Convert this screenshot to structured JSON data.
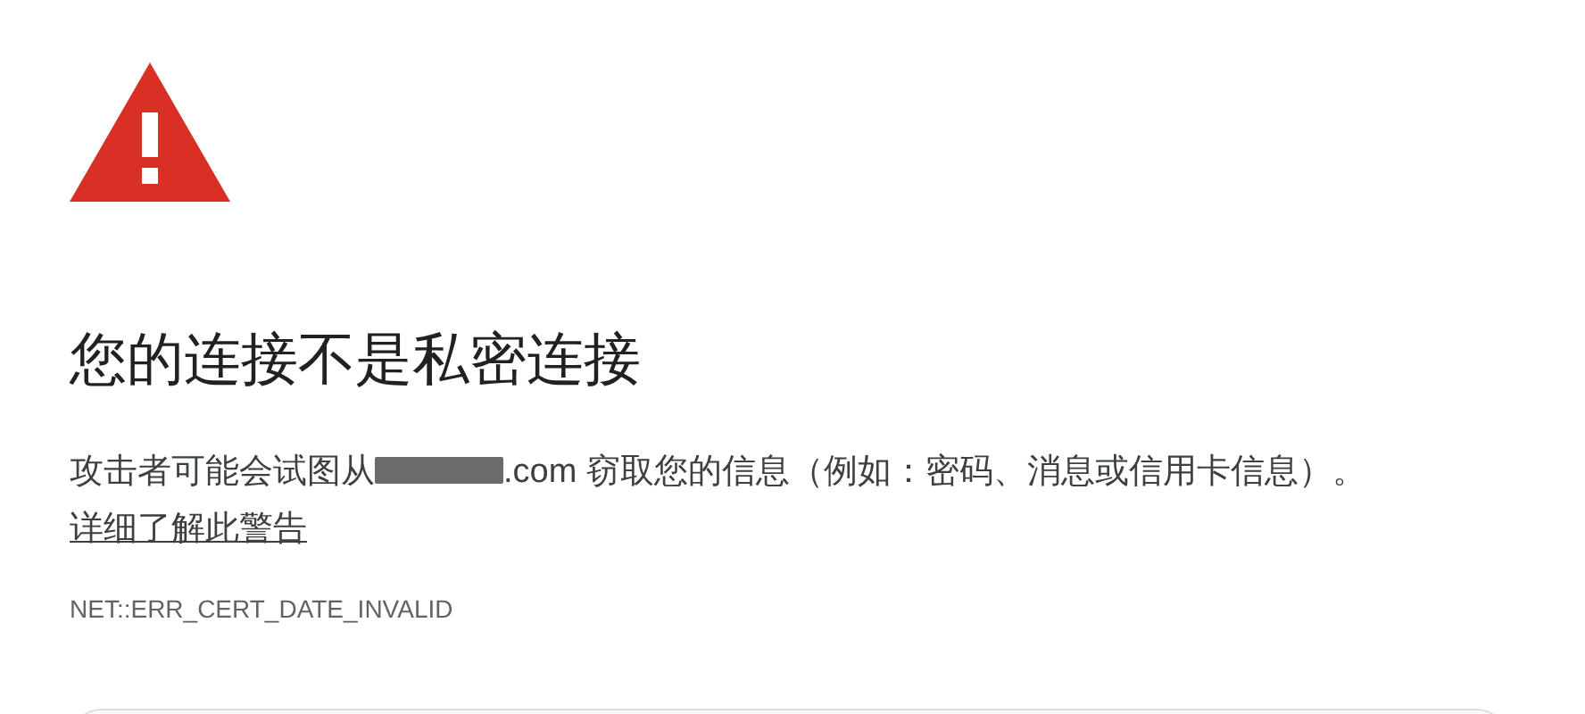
{
  "heading": "您的连接不是私密连接",
  "message": {
    "text_before": "攻击者可能会试图从",
    "text_after": ".com 窃取您的信息（例如：密码、消息或信用卡信息）。",
    "link": "详细了解此警告"
  },
  "error_code": "NET::ERR_CERT_DATE_INVALID"
}
